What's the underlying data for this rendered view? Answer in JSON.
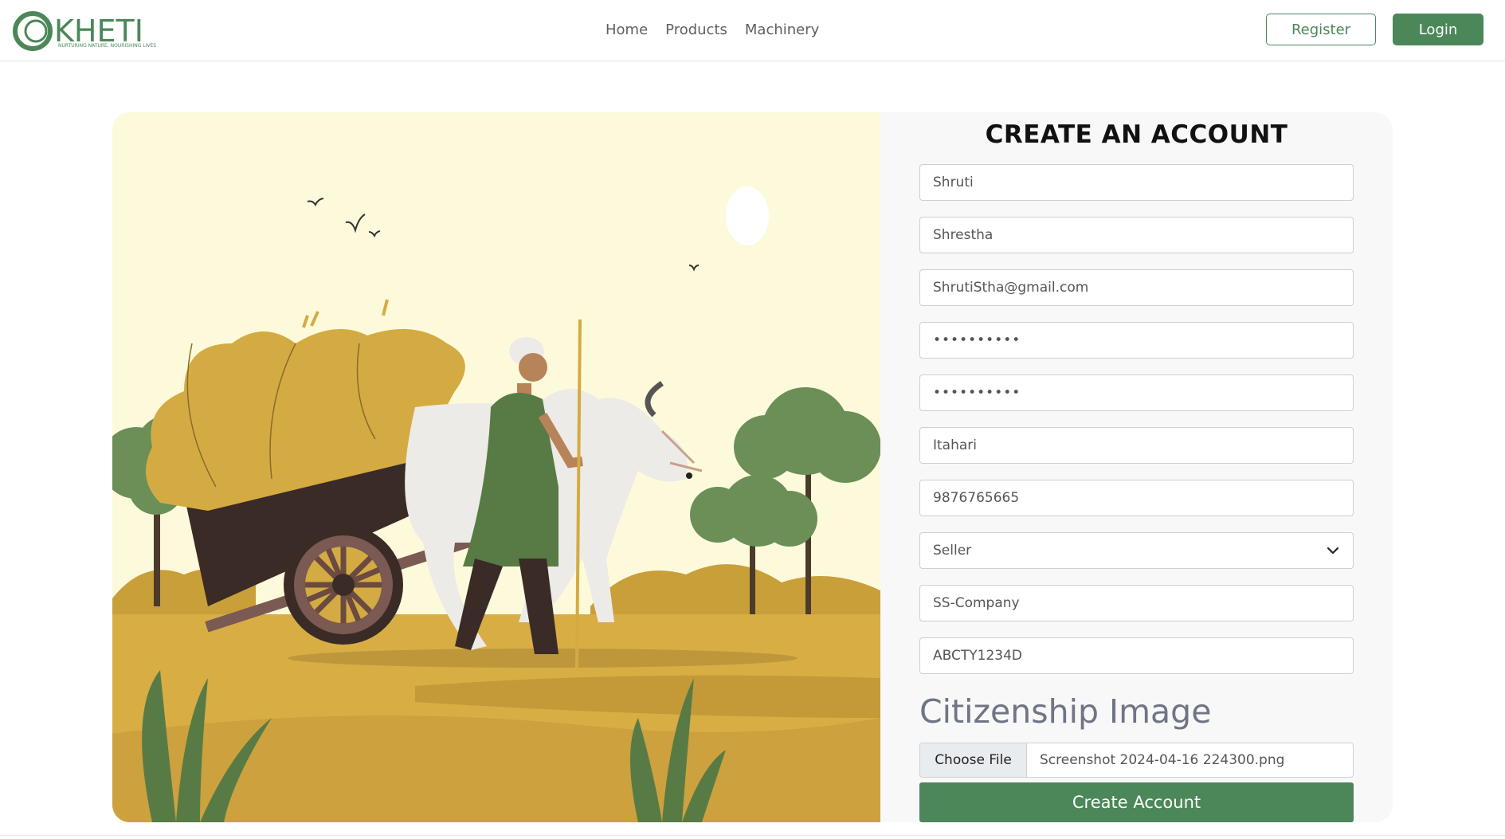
{
  "brand": {
    "name": "KHETI",
    "tagline": "NURTURING NATURE, NOURISHING LIVES",
    "color": "#4b8758"
  },
  "nav": {
    "links": [
      "Home",
      "Products",
      "Machinery"
    ],
    "register_label": "Register",
    "login_label": "Login"
  },
  "form": {
    "title": "CREATE AN ACCOUNT",
    "first_name": "Shruti",
    "last_name": "Shrestha",
    "email": "ShrutiStha@gmail.com",
    "password": "••••••••••",
    "confirm_password": "••••••••••",
    "address": "Itahari",
    "phone": "9876765665",
    "role": "Seller",
    "company": "SS-Company",
    "pan": "ABCTY1234D",
    "citizenship_heading": "Citizenship Image",
    "file_button_label": "Choose File",
    "file_name": "Screenshot 2024-04-16 224300.png",
    "submit_label": "Create Account"
  },
  "colors": {
    "accent": "#4b8758",
    "illustration_bg": "#fdfadb",
    "ground": "#d8ad44",
    "cart": "#3a2b27",
    "hay": "#d4ab42",
    "tree": "#6b8f57",
    "farmer_shirt": "#587b45",
    "ox": "#ecebe7"
  },
  "icons": {
    "select": "chevron-down-icon",
    "logo": "kheti-logo-icon"
  }
}
